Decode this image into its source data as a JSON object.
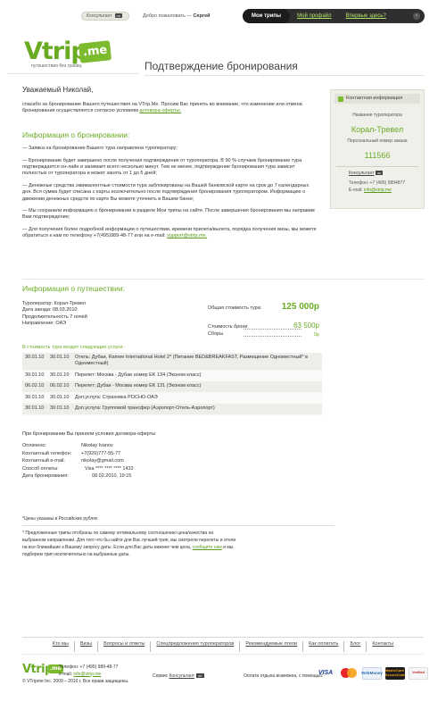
{
  "topbar": {
    "consultant_label": "Консультант",
    "consultant_tag": "on",
    "welcome_text": "Добро пожаловать — ",
    "welcome_user": "Сергей",
    "nav": [
      {
        "label": "Мои трипы",
        "active": true
      },
      {
        "label": "Мой профайл",
        "active": false
      },
      {
        "label": "Впервые здесь?",
        "active": false
      }
    ],
    "close_glyph": "×"
  },
  "logo": {
    "main": "Vtrip",
    "suffix": ".me",
    "slogan": "путешествия без границ"
  },
  "page_title": "Подтверждение бронирования",
  "greeting": "Уважаемый Николай,",
  "intro": {
    "text": "спасибо за бронирование Вашего путешествия на VTrip.Me. Просим Вас принять во внимание, что изменение или отмена бронирования осуществляется согласно условиям ",
    "link": "договора-оферты."
  },
  "booking_info": {
    "heading": "Информация о бронировании:",
    "paragraphs": [
      "— Заявка на бронирование Вашего тура направлена туроператору;",
      "— Бронирование будет завершено после получения подтверждения от туроператора. В 90 % случаев бронирование тура подтверждается он-лайн и занимает всего несколько минут. Тем не менее, подтверждение бронирования тура зависит полностью от туроператора и может занять от 1 до 5 дней;",
      "— Денежные средства эквивалентные стоимости тура заблокированы на Вашей банковской карте на срок до 7 календарных дня. Вся сумма будет списана с карты исключительно после подтверждения бронирования туроператором. Информацию о движении денежных средств по карте Вы можете уточнить в Вашем банке;",
      "— Мы сохранили информацию о бронировании в разделе Мои трипы на сайте. После завершения бронирования мы направим Вам подтверждение;"
    ],
    "last_paragraph": "— Для получения более подробной информации о путешествии, времени прилета/вылета, порядка получения визы, мы можете обратиться к нам по телефону +7(495)989-48-77 или на e-mail: ",
    "last_link": "support@vtrip.me."
  },
  "sidebar": {
    "heading": "Контактная информация",
    "operator_label": "Название туроператора",
    "operator_name": "Корал-Тревел",
    "order_label": "Персональный номер заказа",
    "order_number": "111566",
    "consultant": "Консультант",
    "consultant_tag": "on",
    "phone": "Телефон: +7 (495) 9894877",
    "email_label": "E-mail: ",
    "email": "info@vtrip.me"
  },
  "trip_info": {
    "heading": "Информация о путешествии:",
    "left": [
      "Туроператор: Корал-Тревел",
      "Дата заезда: 08.03.2010",
      "Продолжительность 7 ночей",
      "Направление: ОАЭ"
    ],
    "total_label": "Общая стоимость тура:",
    "total_value": "125 000р",
    "booking_label": "Стоимость брони",
    "booking_value": "63 500р",
    "fees_label": "Сборы",
    "fees_value": "0р"
  },
  "services": {
    "label": "В стоимость тура входят следующие услуги:",
    "rows": [
      {
        "from": "30.01.10",
        "to": "30.01.10",
        "desc": "Отель: Дубаи, Ramee International Hotel 2* (Питание BED&BREAKFAST, Размещение Одноместный* в Одноместный)"
      },
      {
        "from": "30.01.10",
        "to": "30.01.10",
        "desc": "Перелет: Москва - Дубаи номер EK 134 (Эконом класс)"
      },
      {
        "from": "06.02.10",
        "to": "06.02.10",
        "desc": "Перелет: Дубаи - Москва номер EK 131 (Эконом класс)"
      },
      {
        "from": "30.01.10",
        "to": "30.01.10",
        "desc": "Доп.услуга: Страховка РОСНО-ОАЭ"
      },
      {
        "from": "30.01.10",
        "to": "30.01.10",
        "desc": "Доп.услуга: Групповой трансфер (Аэропорт-Отель-Аэропорт)"
      }
    ]
  },
  "acceptance": {
    "title": "При бронировании Вы приняли условия договора-оферты",
    "rows": [
      {
        "k": "Оплачено:",
        "v": "Nikolay Ivanov"
      },
      {
        "k": "Контактный телефон:",
        "v": "+7(926)777-55-77"
      },
      {
        "k": "Контактный e-mail:",
        "v": "nikolay@gmail.com"
      },
      {
        "k": "Способ оплаты:",
        "v": "Visa  **** **** **** 1432"
      },
      {
        "k": "Дата бронирования:",
        "v": "08.02.2010, 19:15"
      }
    ]
  },
  "notes": {
    "n1": "*Цены указаны в Российских рублях",
    "n2": "* Предложенные трипы отобраны по самому оптимальному соотношению цена/качества на выбранном направлении. Для того что бы найти для Вас лучший трип, мы смотрели перелеты и отели на все ближайшие к Вашему запросу даты. Если для Вас даты важнее чем цена, ",
    "n2_link": "сообщите нам",
    "n2_tail": " и мы подберем трип исключительно на выбранные даты."
  },
  "footer": {
    "nav": [
      "Кто мы",
      "Визы",
      "Вопросы и ответы",
      "Спецпредложения туроператоров",
      "Рекомендуемые отели",
      "Как оплатить",
      "Блог",
      "Контакты"
    ],
    "phone": "Телефон: +7 (495) 989-48-77",
    "email_label": "e-mail: ",
    "email": "info@vtrip.me",
    "copyright": "© VTripme Inc. 2009 – 2010 г. Все права защищены.",
    "service_text": "Сервис ",
    "service_link": "Консультант",
    "service_tag": "on",
    "pay_text": "Оплата отдыха возможна, с помощью:",
    "cards": [
      "VISA",
      "MasterCard",
      "WebMoney",
      "MasterCard SecureCode",
      "Verified"
    ]
  }
}
